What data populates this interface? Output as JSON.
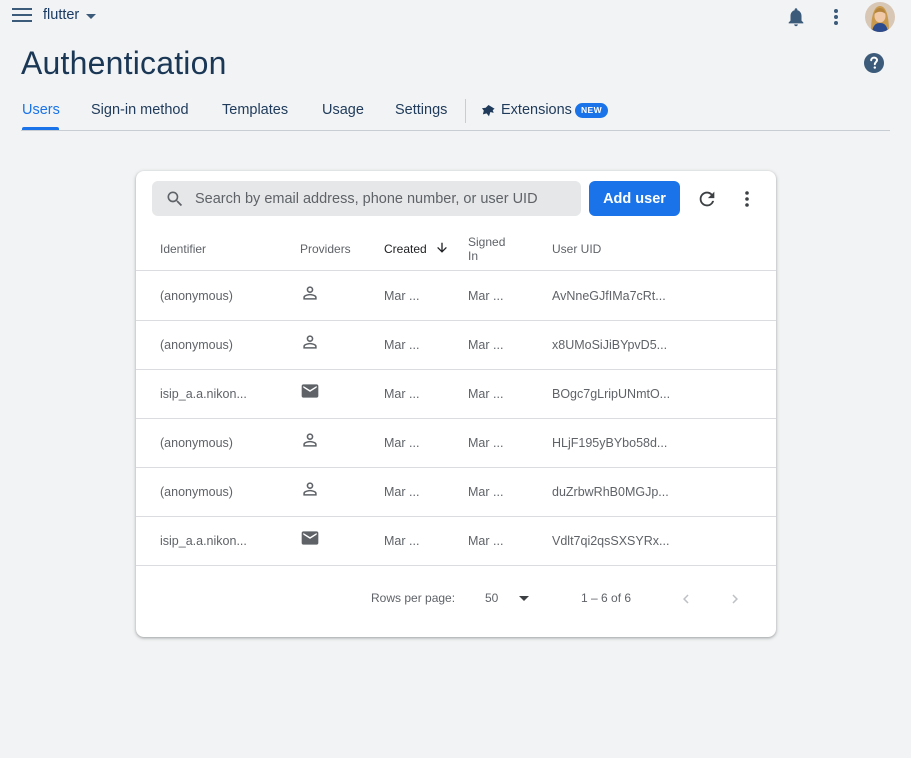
{
  "topbar": {
    "project_name": "flutter",
    "icons": [
      "menu-icon",
      "bell-icon",
      "more-vert-icon",
      "avatar"
    ]
  },
  "page": {
    "title": "Authentication",
    "help_icon": "help-icon"
  },
  "tabs": [
    {
      "label": "Users",
      "active": true
    },
    {
      "label": "Sign-in method",
      "active": false
    },
    {
      "label": "Templates",
      "active": false
    },
    {
      "label": "Usage",
      "active": false
    },
    {
      "label": "Settings",
      "active": false
    },
    {
      "label": "Extensions",
      "active": false,
      "badge": "NEW",
      "icon": "extension-puzzle-icon"
    }
  ],
  "toolbar": {
    "search_placeholder": "Search by email address, phone number, or user UID",
    "search_value": "",
    "add_user_label": "Add user"
  },
  "table": {
    "columns": [
      "Identifier",
      "Providers",
      "Created",
      "Signed\nIn",
      "User UID"
    ],
    "sorted_column": "Created",
    "sort_direction": "descending",
    "rows": [
      {
        "identifier": "(anonymous)",
        "provider": "anonymous-person-icon",
        "created": "Mar ...",
        "signed_in": "Mar ...",
        "uid": "AvNneGJfIMa7cRt..."
      },
      {
        "identifier": "(anonymous)",
        "provider": "anonymous-person-icon",
        "created": "Mar ...",
        "signed_in": "Mar ...",
        "uid": "x8UMoSiJiBYpvD5..."
      },
      {
        "identifier": "isip_a.a.nikon...",
        "provider": "email-envelope-icon",
        "created": "Mar ...",
        "signed_in": "Mar ...",
        "uid": "BOgc7gLripUNmtO..."
      },
      {
        "identifier": "(anonymous)",
        "provider": "anonymous-person-icon",
        "created": "Mar ...",
        "signed_in": "Mar ...",
        "uid": "HLjF195yBYbo58d..."
      },
      {
        "identifier": "(anonymous)",
        "provider": "anonymous-person-icon",
        "created": "Mar ...",
        "signed_in": "Mar ...",
        "uid": "duZrbwRhB0MGJp..."
      },
      {
        "identifier": "isip_a.a.nikon...",
        "provider": "email-envelope-icon",
        "created": "Mar ...",
        "signed_in": "Mar ...",
        "uid": "Vdlt7qi2qsSXSYRx..."
      }
    ]
  },
  "pagination": {
    "rows_per_page_label": "Rows per page:",
    "rows_per_page_value": "50",
    "range_text": "1 – 6 of 6"
  },
  "colors": {
    "accent": "#1a73e8",
    "title": "#1b3756",
    "background": "#f1f3f4"
  }
}
